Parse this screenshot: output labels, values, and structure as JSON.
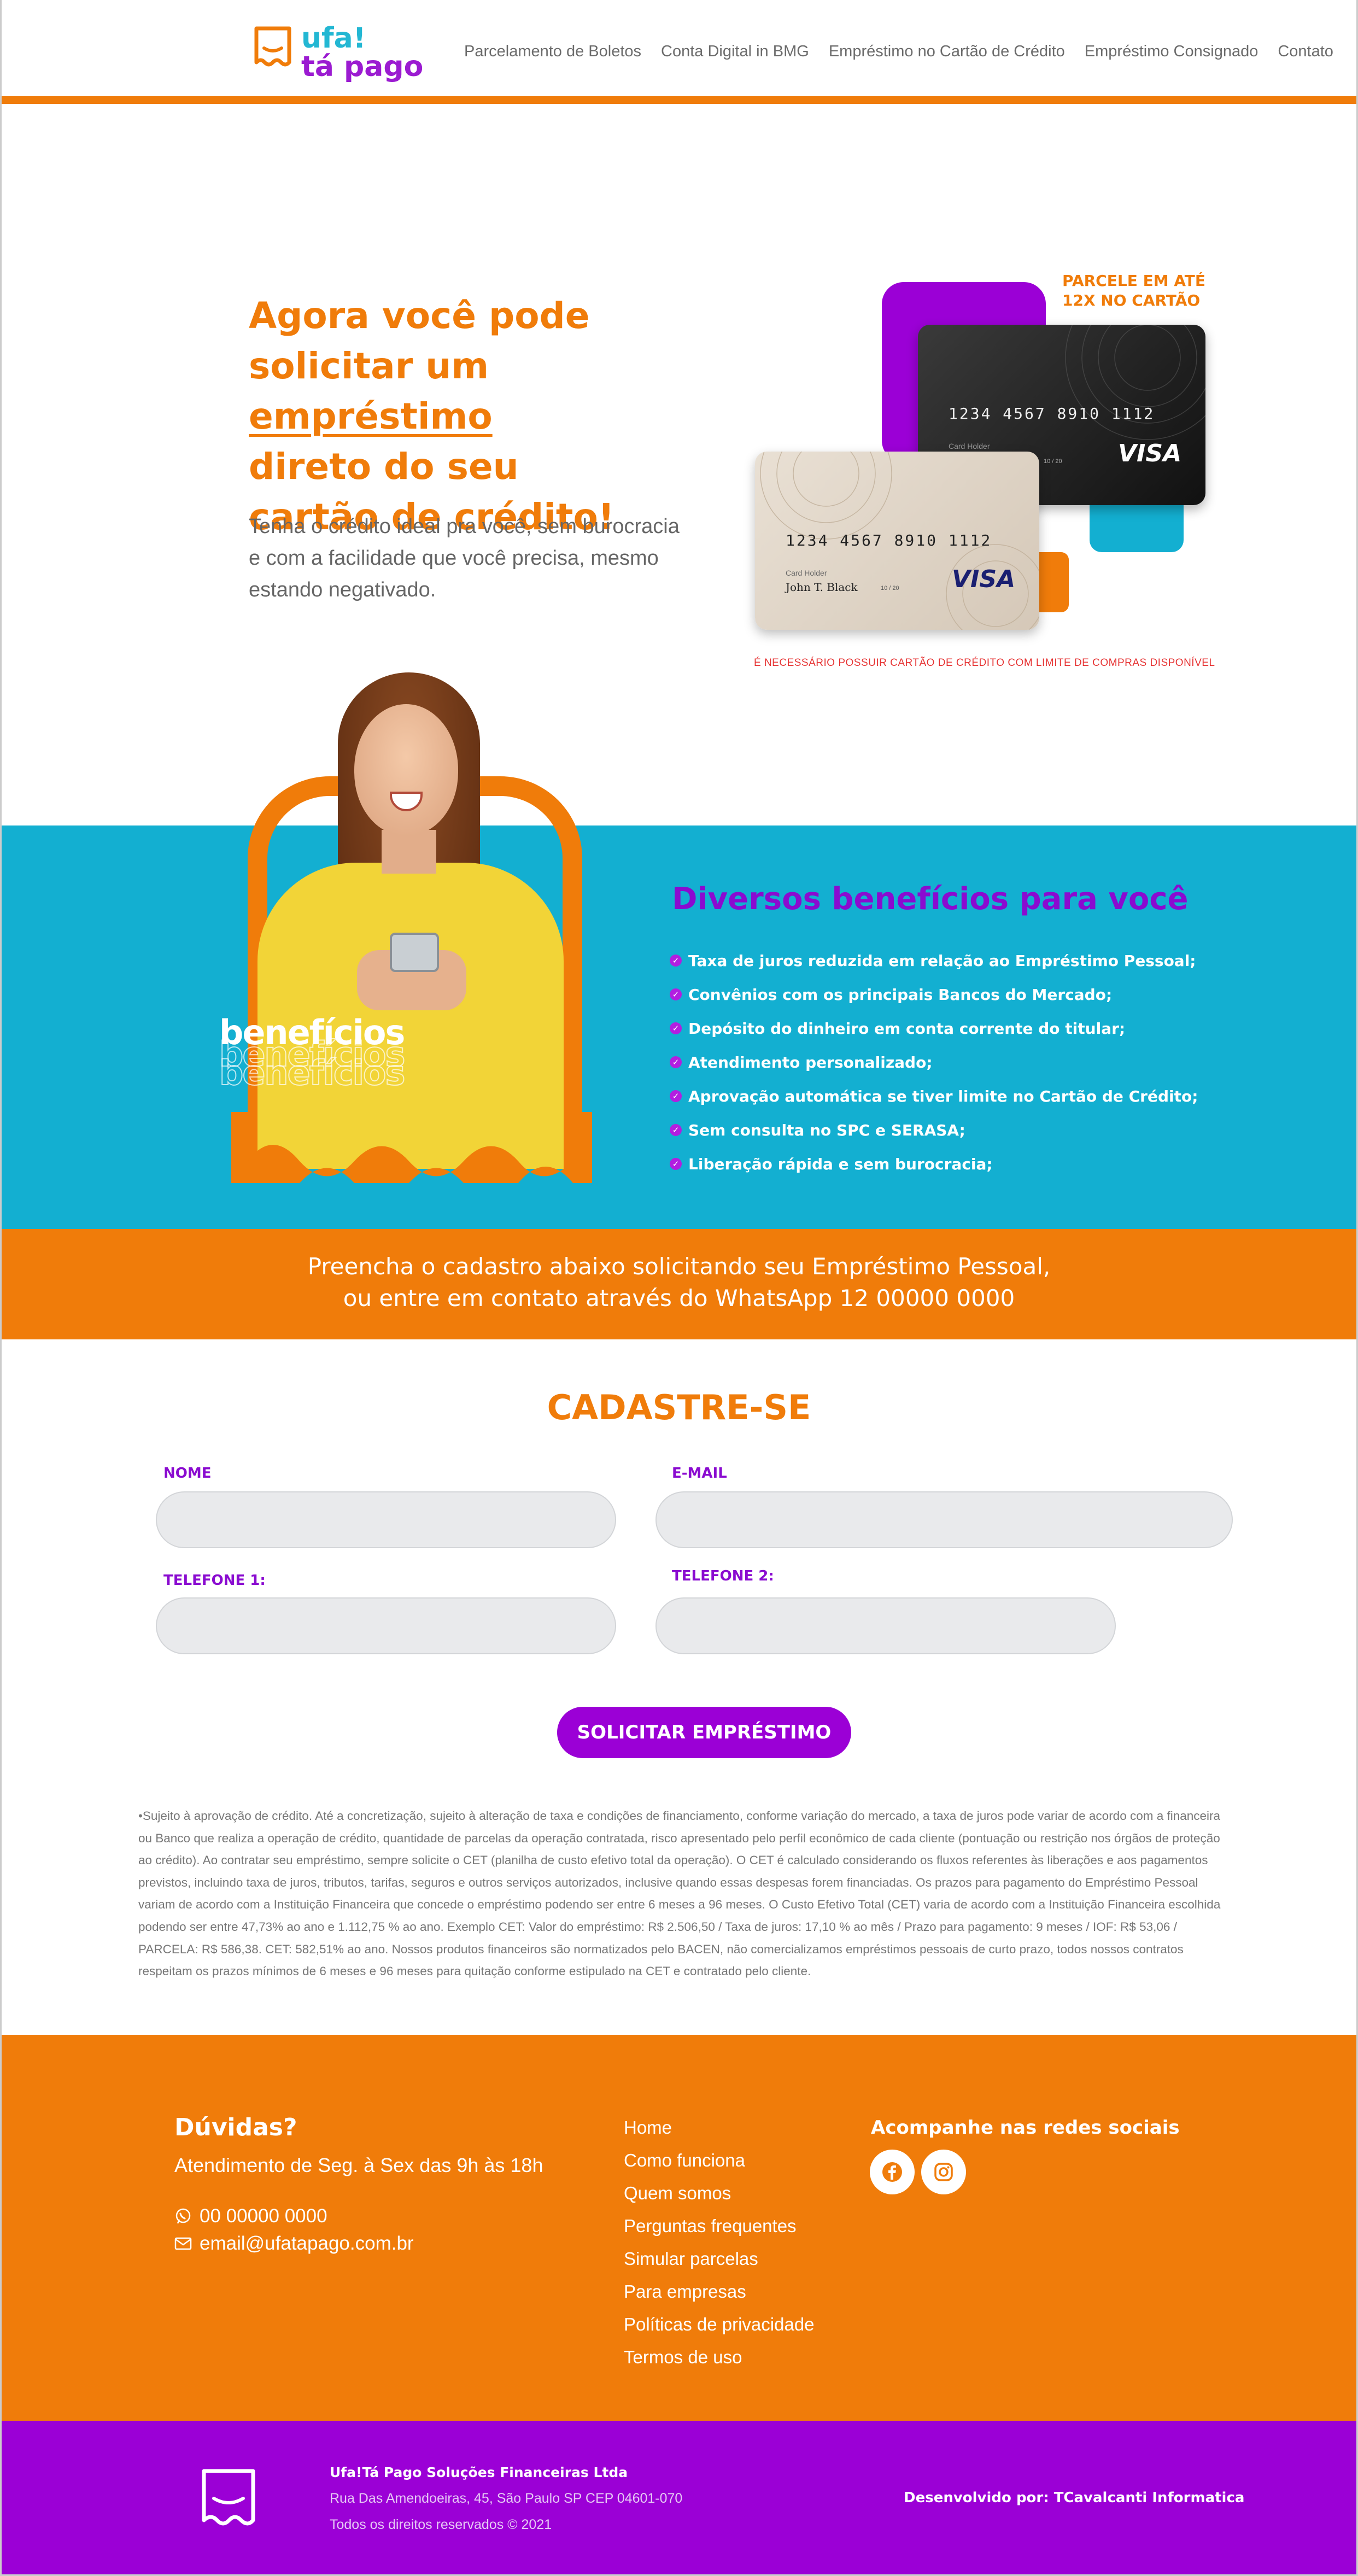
{
  "brand": {
    "line1": "ufa!",
    "line2": "tá pago"
  },
  "nav": [
    "Parcelamento de Boletos",
    "Conta Digital in BMG",
    "Empréstimo no Cartão de Crédito",
    "Empréstimo Consignado",
    "Contato"
  ],
  "hero": {
    "title_l1": "Agora você pode",
    "title_l2a": "solicitar um ",
    "title_l2b": "empréstimo",
    "title_l3": "direto do seu",
    "title_l4": "cartão de crédito!",
    "subtitle": "Tenha o crédito ideal pra você, sem burocracia e com a facilidade que você precisa, mesmo estando negativado.",
    "badge": "PARCELE EM ATÉ 12X NO CARTÃO",
    "notice": "É NECESSÁRIO POSSUIR CARTÃO DE CRÉDITO COM LIMITE DE COMPRAS DISPONÍVEL",
    "card_number": "1234 4567 8910 1112",
    "card_holder_label": "Card Holder",
    "card_holder": "John T. Black",
    "card_expiry": "10 / 20",
    "card_brand": "VISA"
  },
  "benefits": {
    "word": "benefícios",
    "title": "Diversos benefícios para você",
    "items": [
      "Taxa de juros reduzida em relação ao Empréstimo Pessoal;",
      "Convênios com os principais Bancos do Mercado;",
      "Depósito do dinheiro em conta corrente do titular;",
      "Atendimento personalizado;",
      "Aprovação automática se tiver limite no Cartão de Crédito;",
      "Sem consulta no SPC e SERASA;",
      "Liberação rápida e sem burocracia;"
    ]
  },
  "band": {
    "line1": "Preencha o cadastro abaixo solicitando seu Empréstimo Pessoal,",
    "line2": "ou entre em contato através do WhatsApp 12 00000 0000"
  },
  "form": {
    "title": "CADASTRE-SE",
    "name_label": "NOME",
    "email_label": "E-MAIL",
    "phone1_label": "TELEFONE 1:",
    "phone2_label": "TELEFONE 2:",
    "submit": "SOLICITAR EMPRÉSTIMO"
  },
  "legal": "•Sujeito à aprovação de crédito. Até a concretização, sujeito à alteração de taxa e condições de financiamento, conforme variação do mercado, a taxa de juros pode variar de acordo com a financeira ou Banco que realiza a operação de crédito, quantidade de parcelas da operação contratada, risco apresentado pelo perfil econômico de cada cliente (pontuação ou restrição nos órgãos de proteção ao crédito). Ao contratar seu empréstimo, sempre solicite o CET (planilha de custo efetivo total da operação). O CET é calculado considerando os fluxos referentes às liberações e aos pagamentos previstos, incluindo taxa de juros, tributos, tarifas, seguros e outros serviços autorizados, inclusive quando essas despesas forem financiadas. Os prazos para pagamento do Empréstimo Pessoal variam de acordo com a Instituição Financeira que concede o empréstimo podendo ser entre 6 meses a 96 meses. O Custo Efetivo Total (CET) varia de acordo com a Instituição Financeira escolhida podendo ser entre 47,73% ao ano e 1.112,75 % ao ano. Exemplo CET: Valor do empréstimo: R$ 2.506,50 / Taxa de juros: 17,10 % ao mês / Prazo para pagamento: 9 meses / IOF: R$ 53,06 / PARCELA: R$ 586,38. CET: 582,51% ao ano. Nossos produtos financeiros são normatizados pelo BACEN, não comercializamos empréstimos pessoais de curto prazo, todos nossos contratos respeitam os prazos mínimos de 6 meses e 96 meses para quitação conforme estipulado na CET e contratado pelo cliente.",
  "footer": {
    "title": "Dúvidas?",
    "hours": "Atendimento de Seg. à Sex das 9h às 18h",
    "phone": "00 00000 0000",
    "email": "email@ufatapago.com.br",
    "links": [
      "Home",
      "Como funciona",
      "Quem somos",
      "Perguntas frequentes",
      "Simular parcelas",
      "Para empresas",
      "Políticas de privacidade",
      "Termos de uso"
    ],
    "social_title": "Acompanhe nas redes sociais",
    "social_icons": [
      "facebook-icon",
      "instagram-icon"
    ]
  },
  "bottom": {
    "company": "Ufa!Tá Pago Soluções Financeiras Ltda",
    "address": "Rua Das Amendoeiras, 45, São Paulo SP CEP 04601-070",
    "copyright": "Todos os direitos reservados © 2021",
    "developer": "Desenvolvido por: TCavalcanti Informatica"
  },
  "colors": {
    "orange": "#f07c0a",
    "purple": "#9b00d6",
    "blue": "#13afd1"
  }
}
